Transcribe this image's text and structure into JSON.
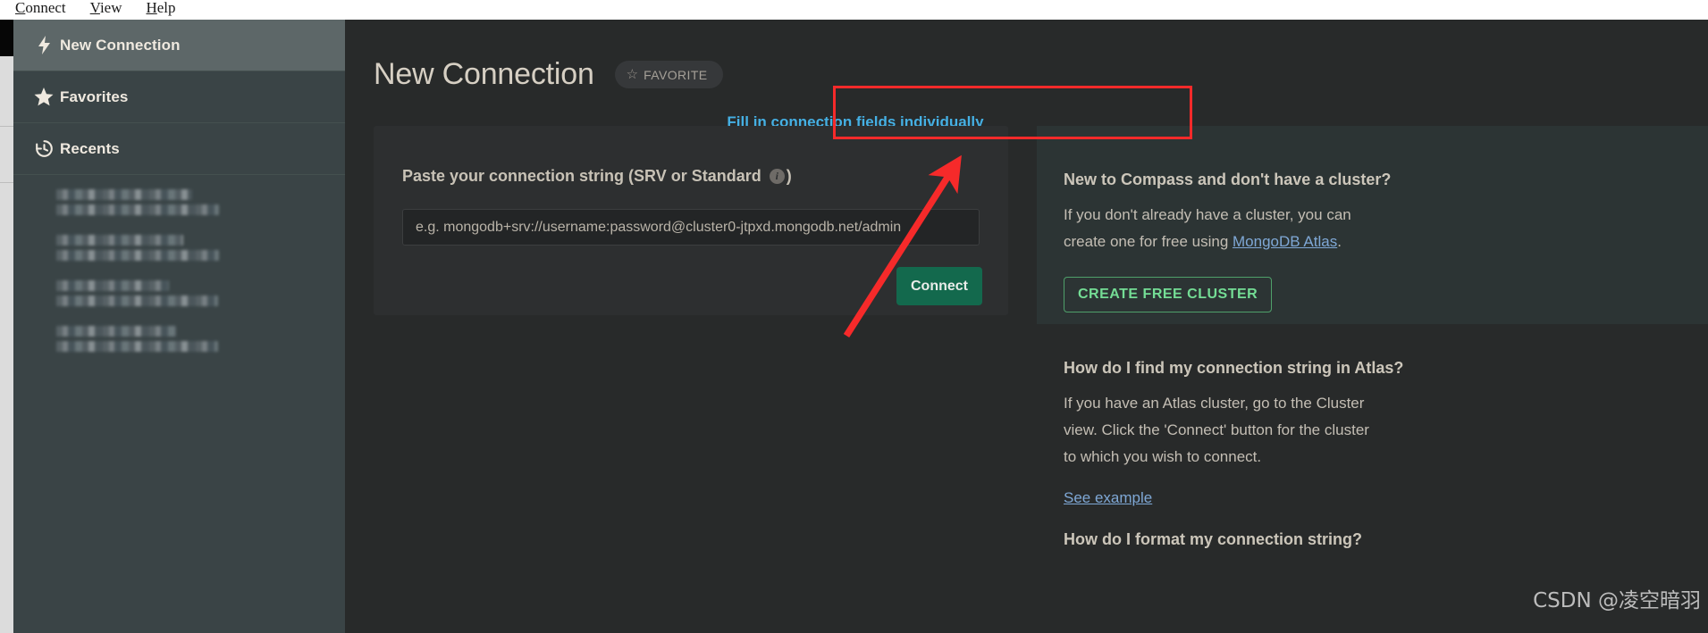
{
  "menubar": {
    "items": [
      {
        "label": "Connect",
        "accel": "C"
      },
      {
        "label": "View",
        "accel": "V"
      },
      {
        "label": "Help",
        "accel": "H"
      }
    ]
  },
  "sidebar": {
    "items": [
      {
        "label": "New Connection",
        "icon": "bolt-icon",
        "active": true
      },
      {
        "label": "Favorites",
        "icon": "star-icon",
        "active": false
      },
      {
        "label": "Recents",
        "icon": "history-icon",
        "active": false
      }
    ],
    "recents": [
      {
        "redacted": true
      },
      {
        "redacted": true
      },
      {
        "redacted": true
      },
      {
        "redacted": true
      }
    ]
  },
  "header": {
    "title": "New Connection",
    "favorite_label": "FAVORITE",
    "favorite_icon": "star-outline-icon"
  },
  "fill_link": {
    "label": "Fill in connection fields individually"
  },
  "connection_form": {
    "label": "Paste your connection string (SRV or Standard",
    "label_suffix": ")",
    "info_icon": "info-icon",
    "input_value": "",
    "input_placeholder": "e.g. mongodb+srv://username:password@cluster0-jtpxd.mongodb.net/admin",
    "connect_label": "Connect"
  },
  "help": {
    "section1": {
      "heading": "New to Compass and don't have a cluster?",
      "body_before": "If you don't already have a cluster, you can create one for free using ",
      "link": "MongoDB Atlas",
      "body_after": ".",
      "button": "CREATE FREE CLUSTER"
    },
    "section2": {
      "heading": "How do I find my connection string in Atlas?",
      "body": "If you have an Atlas cluster, go to the Cluster view. Click the 'Connect' button for the cluster to which you wish to connect.",
      "link": "See example"
    },
    "section3": {
      "heading": "How do I format my connection string?"
    }
  },
  "annotation": {
    "box_color": "#f62a2a",
    "arrow_color": "#f62a2a"
  },
  "watermark": {
    "text": "CSDN @凌空暗羽"
  },
  "colors": {
    "accent_link": "#45b0e4",
    "connect_green": "#13694d",
    "cluster_green": "#74dd95",
    "sidebar_bg": "#3a4446",
    "main_bg": "#282a2a"
  }
}
